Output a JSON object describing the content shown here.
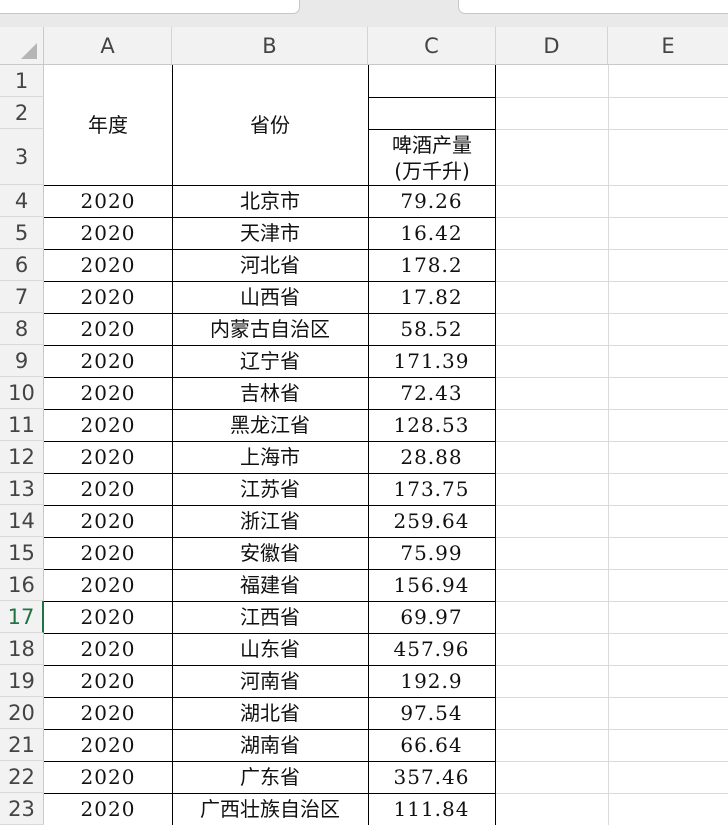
{
  "tabs": [
    {
      "label": "…"
    },
    {
      "label": "…"
    }
  ],
  "columns": [
    "A",
    "B",
    "C",
    "D",
    "E"
  ],
  "row_numbers": [
    "1",
    "2",
    "3",
    "4",
    "5",
    "6",
    "7",
    "8",
    "9",
    "10",
    "11",
    "12",
    "13",
    "14",
    "15",
    "16",
    "17",
    "18",
    "19",
    "20",
    "21",
    "22",
    "23"
  ],
  "active_row": "17",
  "headers": {
    "year": "年度",
    "province": "省份",
    "beer_line1": "啤酒产量",
    "beer_line2": "(万千升)"
  },
  "rows": [
    {
      "year": "2020",
      "province": "北京市",
      "beer": "79.26"
    },
    {
      "year": "2020",
      "province": "天津市",
      "beer": "16.42"
    },
    {
      "year": "2020",
      "province": "河北省",
      "beer": "178.2"
    },
    {
      "year": "2020",
      "province": "山西省",
      "beer": "17.82"
    },
    {
      "year": "2020",
      "province": "内蒙古自治区",
      "beer": "58.52"
    },
    {
      "year": "2020",
      "province": "辽宁省",
      "beer": "171.39"
    },
    {
      "year": "2020",
      "province": "吉林省",
      "beer": "72.43"
    },
    {
      "year": "2020",
      "province": "黑龙江省",
      "beer": "128.53"
    },
    {
      "year": "2020",
      "province": "上海市",
      "beer": "28.88"
    },
    {
      "year": "2020",
      "province": "江苏省",
      "beer": "173.75"
    },
    {
      "year": "2020",
      "province": "浙江省",
      "beer": "259.64"
    },
    {
      "year": "2020",
      "province": "安徽省",
      "beer": "75.99"
    },
    {
      "year": "2020",
      "province": "福建省",
      "beer": "156.94"
    },
    {
      "year": "2020",
      "province": "江西省",
      "beer": "69.97"
    },
    {
      "year": "2020",
      "province": "山东省",
      "beer": "457.96"
    },
    {
      "year": "2020",
      "province": "河南省",
      "beer": "192.9"
    },
    {
      "year": "2020",
      "province": "湖北省",
      "beer": "97.54"
    },
    {
      "year": "2020",
      "province": "湖南省",
      "beer": "66.64"
    },
    {
      "year": "2020",
      "province": "广东省",
      "beer": "357.46"
    },
    {
      "year": "2020",
      "province": "广西壮族自治区",
      "beer": "111.84"
    }
  ]
}
